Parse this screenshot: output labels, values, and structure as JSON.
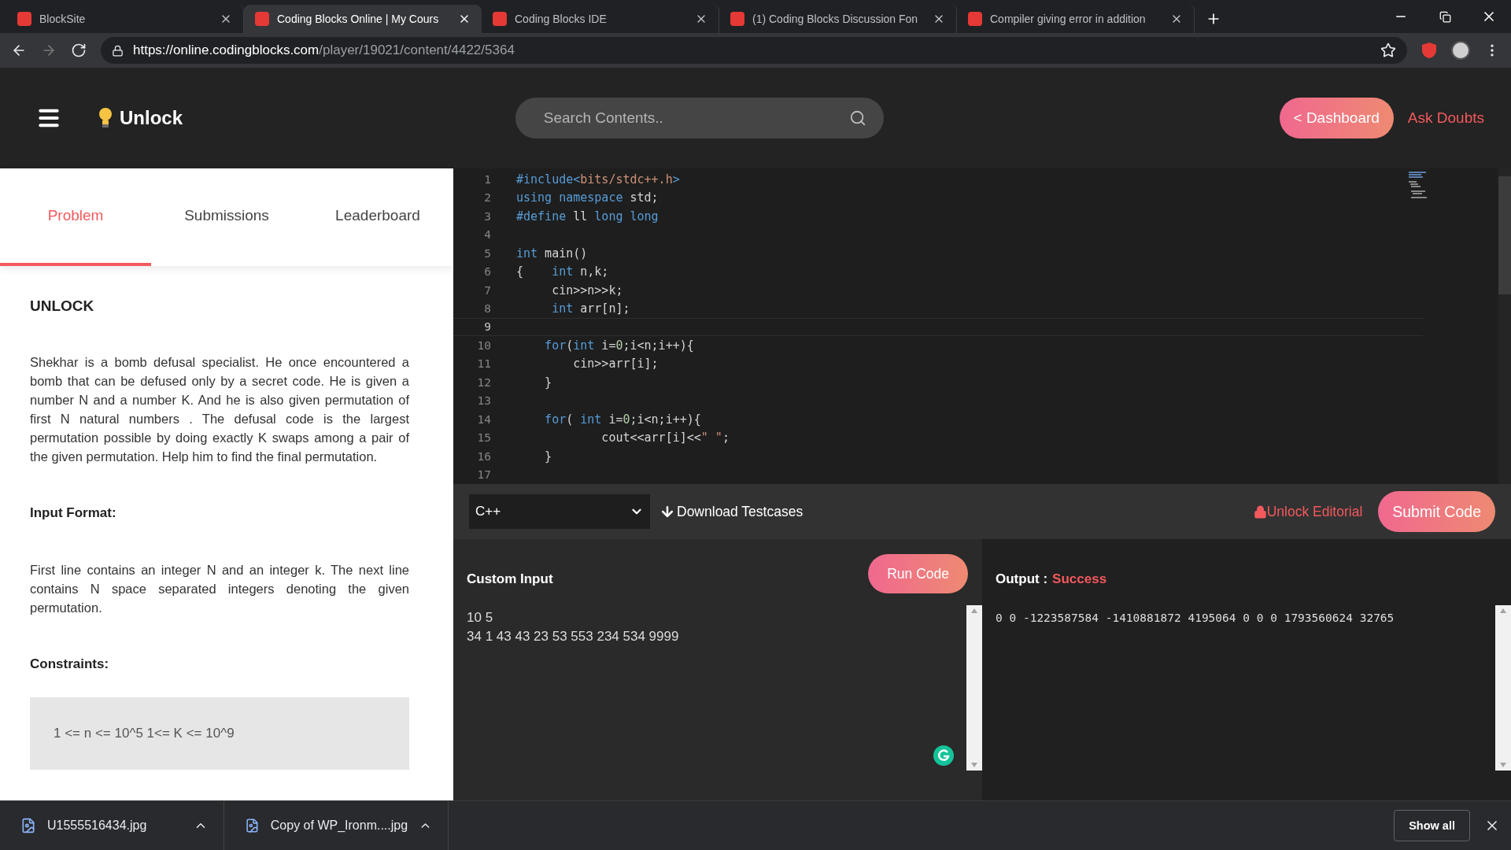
{
  "browser": {
    "tabs": [
      {
        "title": "BlockSite",
        "selected": false
      },
      {
        "title": "Coding Blocks Online | My Cours",
        "selected": true
      },
      {
        "title": "Coding Blocks IDE",
        "selected": false
      },
      {
        "title": "(1) Coding Blocks Discussion Fon",
        "selected": false
      },
      {
        "title": "Compiler giving error in addition",
        "selected": false
      }
    ],
    "url_host": "https://online.codingblocks.com",
    "url_path": "/player/19021/content/4422/5364"
  },
  "header": {
    "title": "Unlock",
    "search_placeholder": "Search Contents..",
    "dashboard_button": "< Dashboard",
    "ask_doubts": "Ask Doubts"
  },
  "problem_tabs": [
    {
      "label": "Problem",
      "selected": true
    },
    {
      "label": "Submissions",
      "selected": false
    },
    {
      "label": "Leaderboard",
      "selected": false
    }
  ],
  "problem": {
    "title": "UNLOCK",
    "statement": "Shekhar is a bomb defusal specialist. He once encountered a bomb that can be defused only by a secret code. He is given a number N and a number K. And he is also given permutation of first N natural numbers . The defusal code is the largest permutation possible by doing exactly K swaps among a pair of the given permutation. Help him to find the final permutation.",
    "sections": [
      {
        "heading": "Input Format:",
        "kind": "text",
        "body": "First line contains an integer N and an integer k. The next line contains N space separated integers denoting the given permutation."
      },
      {
        "heading": "Constraints:",
        "kind": "box",
        "body": "1 <= n <= 10^5 1<= K <= 10^9"
      }
    ]
  },
  "editor": {
    "lines": [
      {
        "number": "1",
        "current": false,
        "tokens": [
          {
            "text": "#include<",
            "kind": "keyword"
          },
          {
            "text": "bits/stdc++.h",
            "kind": "string"
          },
          {
            "text": ">",
            "kind": "keyword"
          }
        ]
      },
      {
        "number": "2",
        "current": false,
        "tokens": [
          {
            "text": "using namespace",
            "kind": "keyword"
          },
          {
            "text": " std;",
            "kind": "plain"
          }
        ]
      },
      {
        "number": "3",
        "current": false,
        "tokens": [
          {
            "text": "#define",
            "kind": "keyword"
          },
          {
            "text": " ll ",
            "kind": "plain"
          },
          {
            "text": "long long",
            "kind": "keyword"
          }
        ]
      },
      {
        "number": "4",
        "current": false
      },
      {
        "number": "5",
        "current": false,
        "tokens": [
          {
            "text": "int",
            "kind": "keyword"
          },
          {
            "text": " main()",
            "kind": "plain"
          }
        ]
      },
      {
        "number": "6",
        "current": false,
        "tokens": [
          {
            "text": "{    ",
            "kind": "plain"
          },
          {
            "text": "int",
            "kind": "keyword"
          },
          {
            "text": " n,k;",
            "kind": "plain"
          }
        ]
      },
      {
        "number": "7",
        "current": false,
        "tokens": [
          {
            "text": "     cin>>n>>k;",
            "kind": "plain"
          }
        ]
      },
      {
        "number": "8",
        "current": false,
        "tokens": [
          {
            "text": "     int",
            "kind": "keyword"
          },
          {
            "text": " arr[n];",
            "kind": "plain"
          }
        ]
      },
      {
        "number": "9",
        "current": true
      },
      {
        "number": "10",
        "current": false,
        "tokens": [
          {
            "text": "    for",
            "kind": "keyword"
          },
          {
            "text": "(",
            "kind": "plain"
          },
          {
            "text": "int",
            "kind": "keyword"
          },
          {
            "text": " i=",
            "kind": "plain"
          },
          {
            "text": "0",
            "kind": "number"
          },
          {
            "text": ";i<n;i++){",
            "kind": "plain"
          }
        ]
      },
      {
        "number": "11",
        "current": false,
        "tokens": [
          {
            "text": "        cin>>arr[i];",
            "kind": "plain"
          }
        ]
      },
      {
        "number": "12",
        "current": false,
        "tokens": [
          {
            "text": "    }",
            "kind": "plain"
          }
        ]
      },
      {
        "number": "13",
        "current": false
      },
      {
        "number": "14",
        "current": false,
        "tokens": [
          {
            "text": "    for",
            "kind": "keyword"
          },
          {
            "text": "( ",
            "kind": "plain"
          },
          {
            "text": "int",
            "kind": "keyword"
          },
          {
            "text": " i=",
            "kind": "plain"
          },
          {
            "text": "0",
            "kind": "number"
          },
          {
            "text": ";i<n;i++){",
            "kind": "plain"
          }
        ]
      },
      {
        "number": "15",
        "current": false,
        "tokens": [
          {
            "text": "            cout<<arr[i]<<",
            "kind": "plain"
          },
          {
            "text": "\" \"",
            "kind": "string"
          },
          {
            "text": ";",
            "kind": "plain"
          }
        ]
      },
      {
        "number": "16",
        "current": false,
        "tokens": [
          {
            "text": "    }",
            "kind": "plain"
          }
        ]
      },
      {
        "number": "17",
        "current": false
      }
    ]
  },
  "toolbar": {
    "language": "C++",
    "download": "Download Testcases",
    "unlock_editorial": "Unlock Editorial",
    "submit": "Submit Code"
  },
  "input": {
    "label": "Custom Input",
    "run": "Run Code",
    "value": "10 5\n34 1 43 43 23 53 553 234 534 9999"
  },
  "output": {
    "label": "Output :",
    "status": "Success",
    "value": "0 0 -1223587584 -1410881872 4195064 0 0 0 1793560624 32765"
  },
  "downloads": {
    "files": [
      "U1555516434.jpg",
      "Copy of WP_Ironm....jpg"
    ],
    "show_all": "Show all"
  }
}
